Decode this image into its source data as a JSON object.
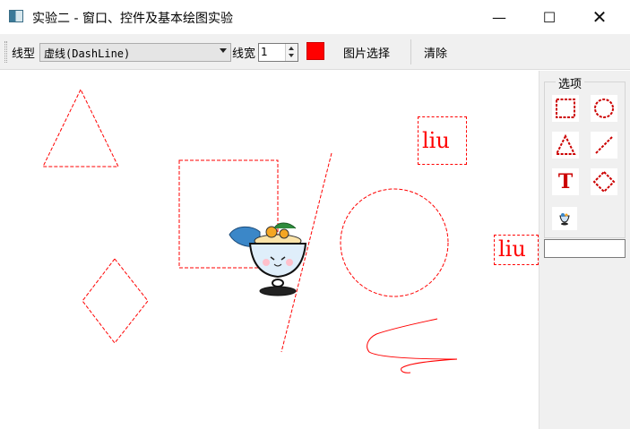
{
  "window": {
    "title": "实验二 - 窗口、控件及基本绘图实验",
    "minimize_glyph": "—",
    "maximize_glyph": "☐",
    "close_glyph": "✕"
  },
  "toolbar": {
    "line_style_label": "线型",
    "line_style_value": "虚线(DashLine)",
    "line_width_label": "线宽",
    "line_width_value": "1",
    "pen_color": "#ff0000",
    "pick_image_label": "图片选择",
    "clear_label": "清除"
  },
  "canvas": {
    "stroke_color": "#ff0000",
    "text_items": [
      "liu",
      "liu"
    ]
  },
  "options_panel": {
    "title": "选项",
    "tool_color": "#cc0000",
    "tools": [
      "rectangle-icon",
      "ellipse-icon",
      "triangle-icon",
      "line-icon",
      "text-icon",
      "diamond-icon",
      "image-icon"
    ],
    "text_tool_glyph": "T",
    "text_input_value": ""
  }
}
